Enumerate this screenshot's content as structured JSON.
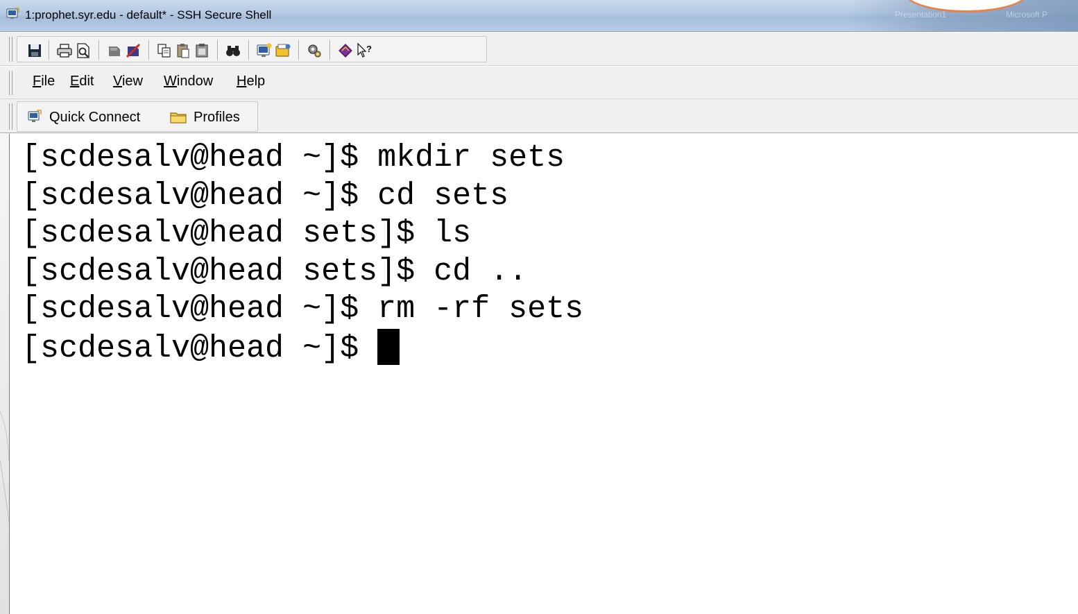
{
  "window": {
    "title": "1:prophet.syr.edu - default* - SSH Secure Shell",
    "faded_right_text": [
      "Presentation1",
      "Microsoft P"
    ]
  },
  "toolbar": {
    "icons": [
      "save-icon",
      "print-icon",
      "print-preview-icon",
      "connect-icon",
      "disconnect-icon",
      "copy-icon",
      "paste-icon",
      "paste-alt-icon",
      "find-icon",
      "new-terminal-icon",
      "new-file-transfer-icon",
      "settings-icon",
      "help-book-icon",
      "context-help-icon"
    ]
  },
  "menu": {
    "items": [
      {
        "accel": "F",
        "rest": "ile"
      },
      {
        "accel": "E",
        "rest": "dit"
      },
      {
        "accel": "V",
        "rest": "iew"
      },
      {
        "accel": "W",
        "rest": "indow"
      },
      {
        "accel": "H",
        "rest": "elp"
      }
    ]
  },
  "quickbar": {
    "quick_connect": "Quick Connect",
    "profiles": "Profiles"
  },
  "terminal": {
    "lines": [
      "[scdesalv@head ~]$ mkdir sets",
      "[scdesalv@head ~]$ cd sets",
      "[scdesalv@head sets]$ ls",
      "[scdesalv@head sets]$ cd ..",
      "[scdesalv@head ~]$ rm -rf sets",
      "[scdesalv@head ~]$ "
    ]
  },
  "colors": {
    "titlebar": "#b3c8e1",
    "toolbar_bg": "#f0f0f0",
    "terminal_bg": "#ffffff",
    "terminal_fg": "#000000",
    "accent_orange": "#e8814b"
  }
}
